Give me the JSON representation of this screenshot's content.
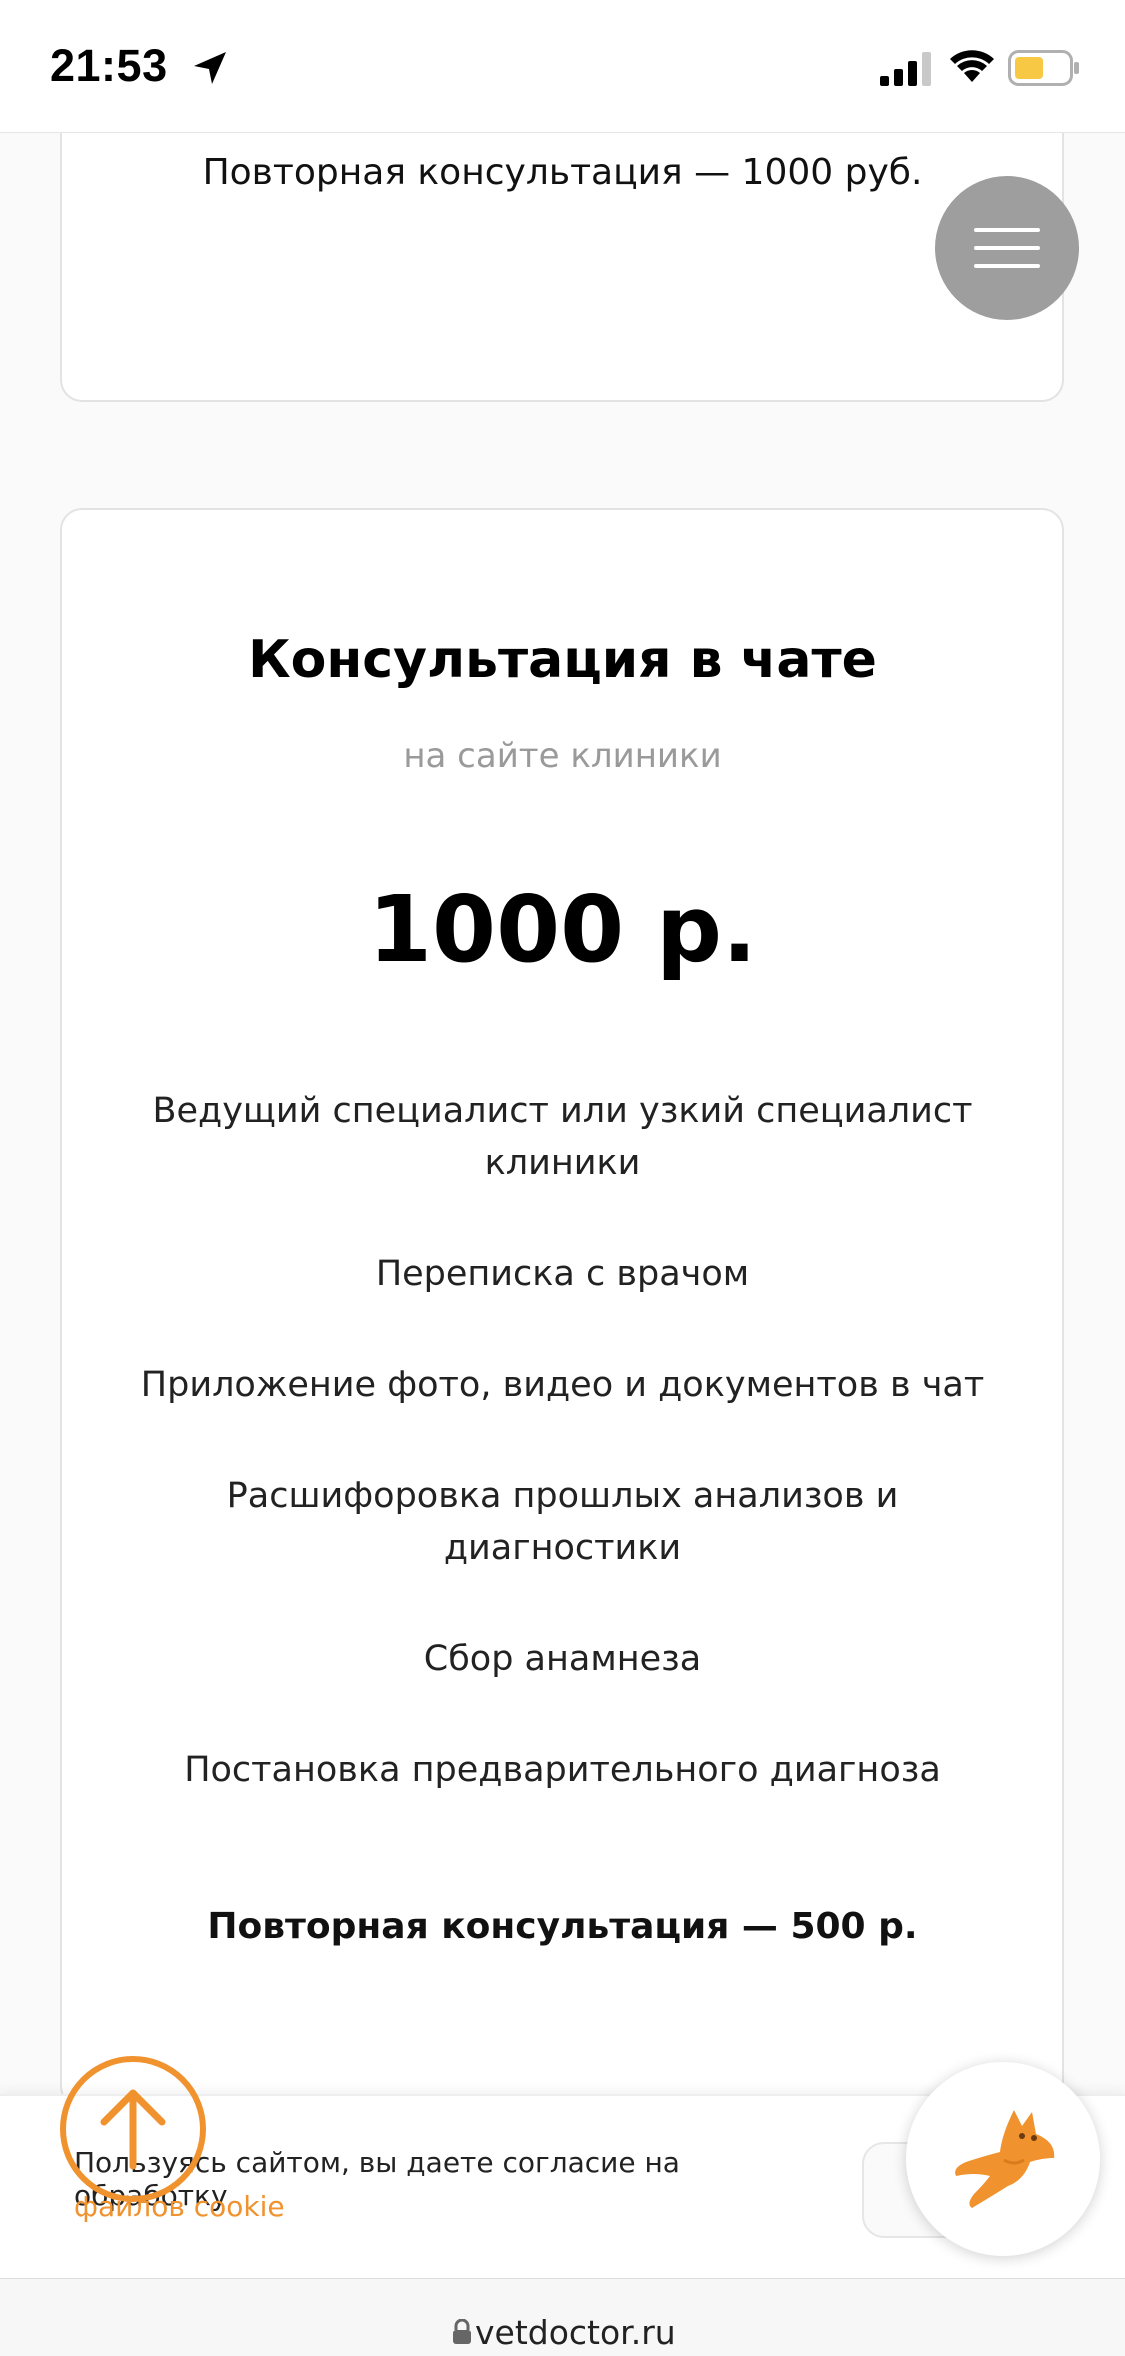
{
  "status_bar": {
    "time": "21:53",
    "battery_color": "#f6c844"
  },
  "previous_card": {
    "repeat_text": "Повторная консультация — 1000 руб."
  },
  "main_card": {
    "title": "Консультация в чате",
    "subtitle": "на сайте клиники",
    "price": "1000 р.",
    "features": [
      "Ведущий специалист или узкий специалист клиники",
      "Переписка с врачом",
      "Приложение фото, видео и документов в чат",
      "Расшифоровка прошлых анализов и диагностики",
      "Сбор анамнеза",
      "Постановка предварительного диагноза"
    ],
    "repeat_text": "Повторная консультация — 500 р."
  },
  "cookie": {
    "text": "Пользуясь сайтом, вы даете согласие на обработку",
    "link": "файлов cookie",
    "accent_color": "#f0922e"
  },
  "browser": {
    "url": "vetdoctor.ru"
  },
  "icons": {
    "menu": "hamburger-menu-icon",
    "scroll_top": "arrow-up-icon",
    "chat": "cat-chat-icon"
  }
}
